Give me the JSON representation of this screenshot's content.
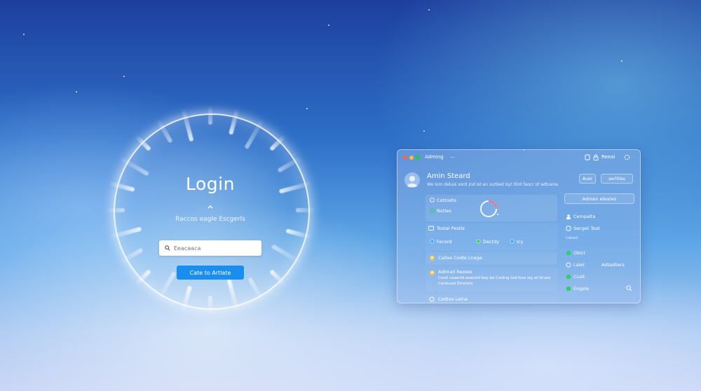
{
  "login": {
    "title": "Login",
    "subtitle": "Raccos eagle Escgerls",
    "search_placeholder": "Eeacaaca",
    "submit_label": "Cate to Artlate"
  },
  "admin": {
    "window_title": "Adming",
    "window_dash": "—",
    "toolbar_label": "Reeai",
    "header_title": "Amin Steard",
    "header_subtitle": "We lom deluol sord jnd ist en xutleet by! tlint faocr of adtuane",
    "header_buttons": [
      "Auer",
      "aerltiles"
    ],
    "cards": {
      "c1_title": "Cottrelts",
      "c1_item": "Notles",
      "c2_title": "Tostal Pestle",
      "c2_items": [
        "Fecerd",
        "Dectdy",
        "Icy"
      ],
      "c3_title": "Caltes Cedle Lnage",
      "c4_title": "Adlmall Reotes",
      "c4_body_1": "Conit usaertd aweolid bey be Cading tod ttoe wg all brues",
      "c4_body_2": "Conbusel Emetely",
      "c5_title": "Cedtes Leine"
    },
    "panel": {
      "head": "Admen eleates",
      "items": [
        "Cempalta",
        "Secget Teat",
        "Claned",
        "Obict",
        "Lalet",
        "Cuslt",
        "Engele"
      ],
      "side_label": "Adtadliers"
    }
  },
  "colors": {
    "accent": "#1a8ef0",
    "close": "#ff5f57",
    "minimize": "#febc2e",
    "maximize": "#28c840",
    "status_green": "#2fd06a",
    "status_blue": "#3fa6ff",
    "donut_red": "#ff6b6b"
  },
  "icons": [
    "search-icon",
    "chevron-up-icon",
    "avatar-icon",
    "lock-icon",
    "donut-chart-icon",
    "gear-icon"
  ]
}
